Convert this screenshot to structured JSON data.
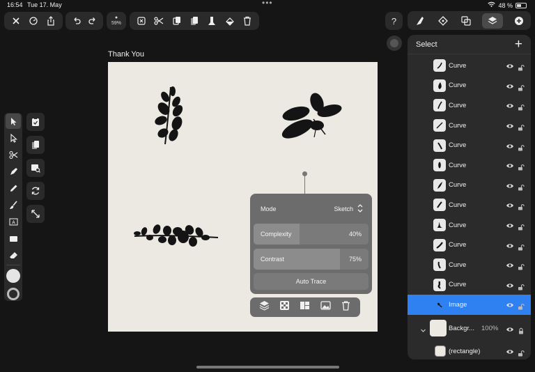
{
  "status_bar": {
    "time": "16:54",
    "date": "Tue 17. May",
    "battery": "48 %"
  },
  "toolbar": {
    "zoom_label": "59%"
  },
  "artboard": {
    "title": "Thank You"
  },
  "layers_panel": {
    "title": "Select",
    "layers": [
      {
        "name": "Curve"
      },
      {
        "name": "Curve"
      },
      {
        "name": "Curve"
      },
      {
        "name": "Curve"
      },
      {
        "name": "Curve"
      },
      {
        "name": "Curve"
      },
      {
        "name": "Curve"
      },
      {
        "name": "Curve"
      },
      {
        "name": "Curve"
      },
      {
        "name": "Curve"
      },
      {
        "name": "Curve"
      },
      {
        "name": "Curve"
      },
      {
        "name": "Image",
        "selected": true
      }
    ],
    "background_group": {
      "name": "Backgr...",
      "opacity": "100%"
    },
    "rectangle_layer": {
      "name": "(rectangle)"
    }
  },
  "auto_trace": {
    "mode_label": "Mode",
    "mode_value": "Sketch",
    "complexity_label": "Complexity",
    "complexity_value": "40%",
    "complexity_level": 0.4,
    "contrast_label": "Contrast",
    "contrast_value": "75%",
    "contrast_level": 0.75,
    "button_label": "Auto Trace"
  },
  "colors": {
    "selected_row": "#2f80f0",
    "panel_bg": "#6c6c6c",
    "canvas_bg": "#ece9e3"
  }
}
